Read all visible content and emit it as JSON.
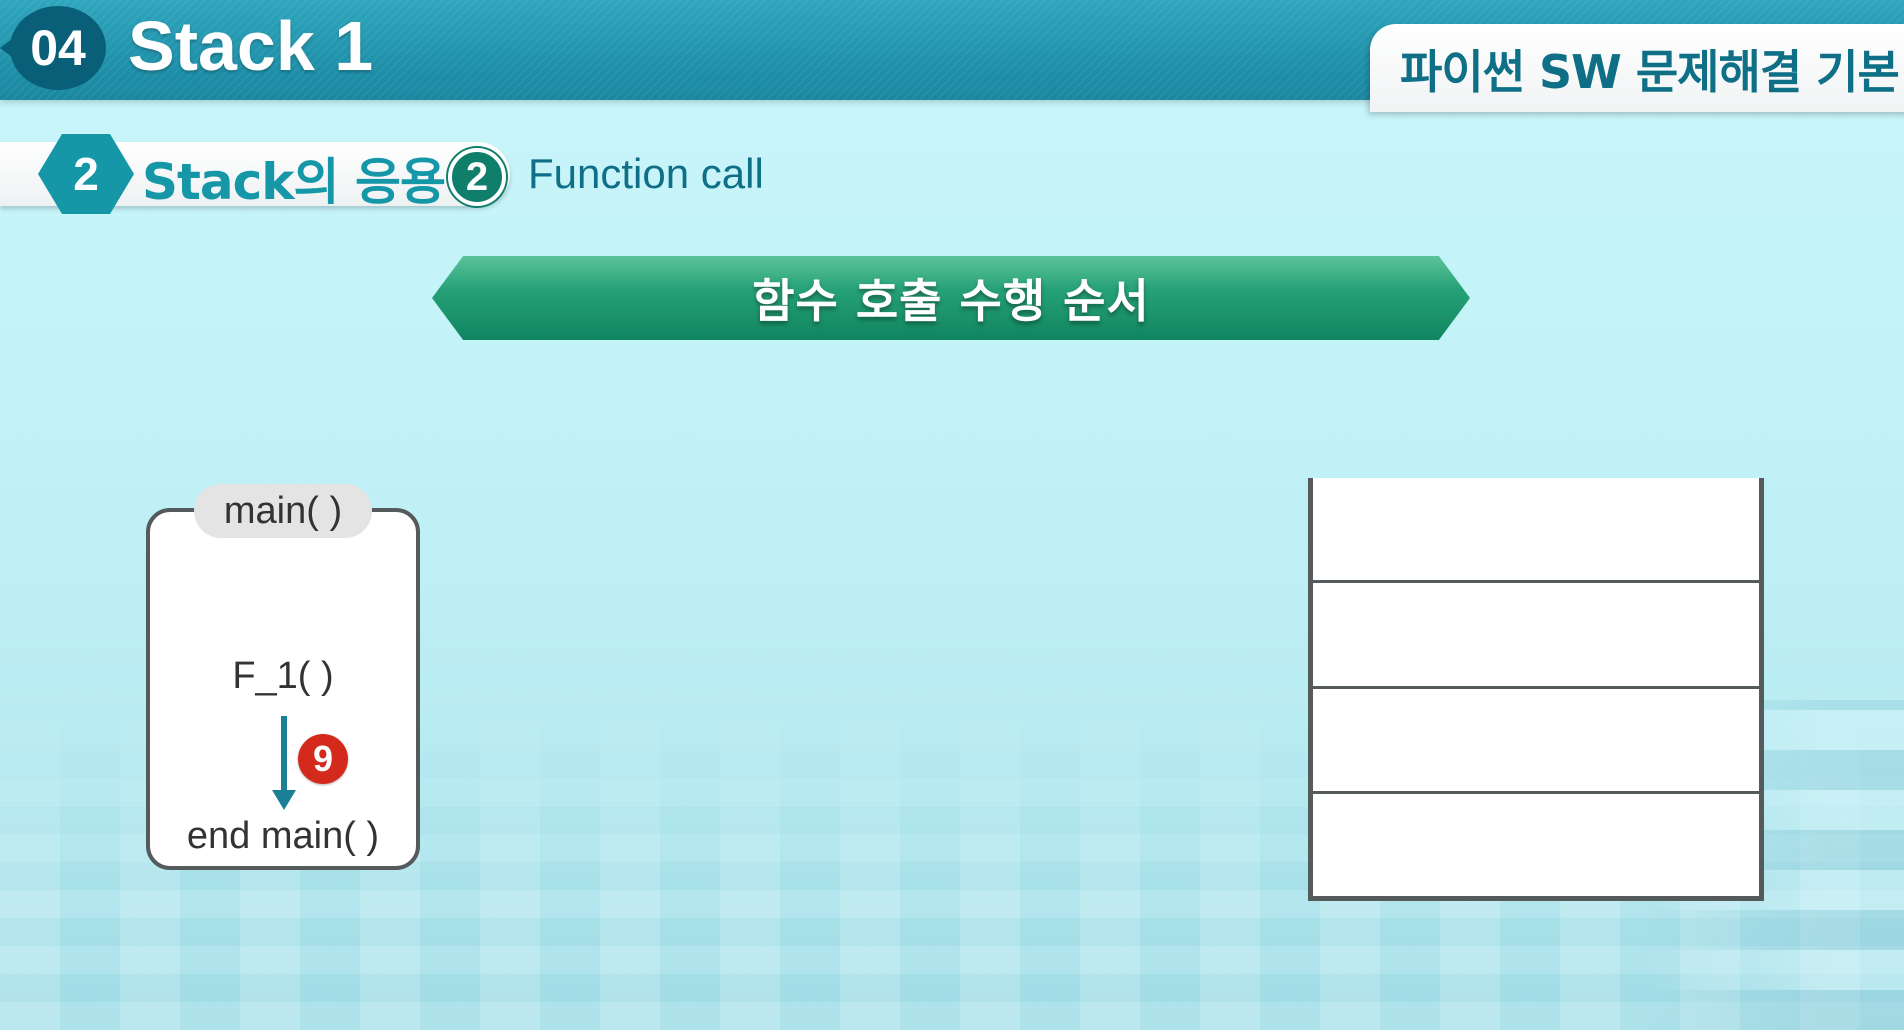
{
  "header": {
    "chapter_number": "04",
    "chapter_title": "Stack 1",
    "course_title": "파이썬 SW 문제해결 기본"
  },
  "section": {
    "number": "2",
    "title": "Stack의 응용",
    "sub_number": "2",
    "sub_title": "Function call"
  },
  "banner": {
    "title": "함수 호출 수행 순서"
  },
  "function_box": {
    "name": "main( )",
    "call": "F_1( )",
    "end": "end main( )",
    "step_number": "9"
  },
  "stack": {
    "slot_count": 4,
    "slots": [
      "",
      "",
      "",
      ""
    ]
  },
  "colors": {
    "header": "#1d8fa8",
    "accent_teal": "#1597a8",
    "banner_green": "#26a177",
    "step_red": "#d42a1c",
    "box_border": "#555a5c"
  }
}
